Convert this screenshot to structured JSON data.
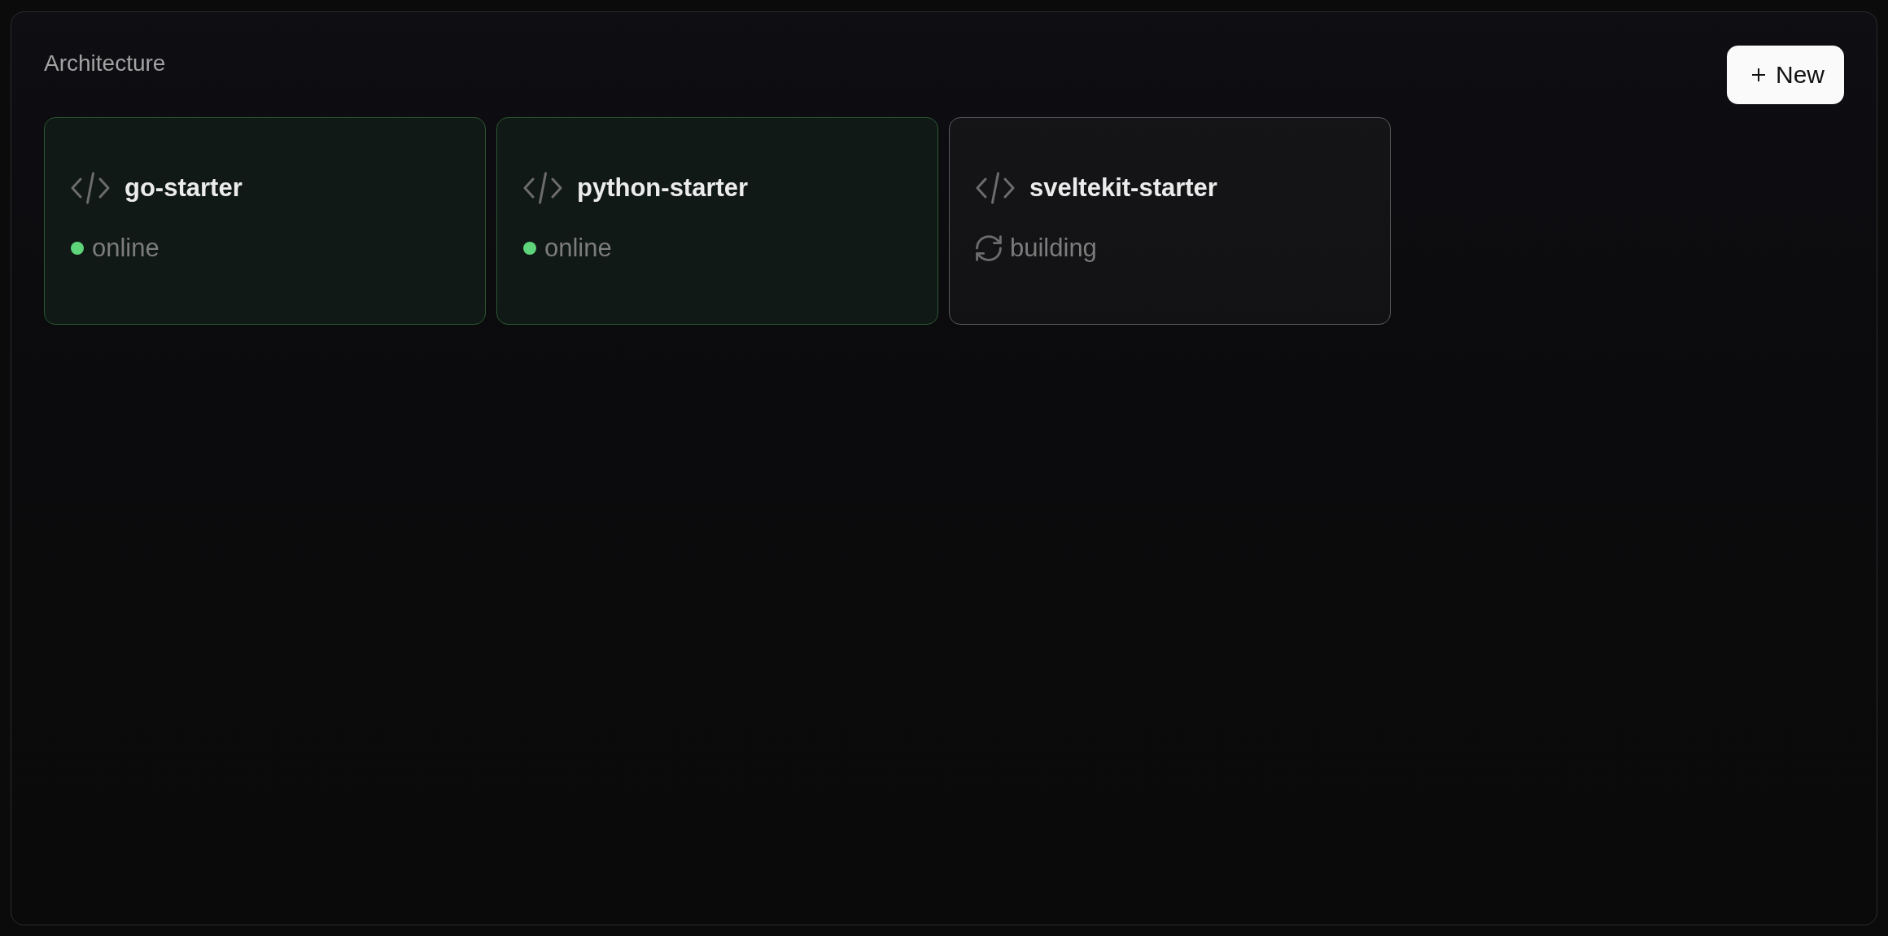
{
  "panel": {
    "title": "Architecture"
  },
  "new_button": {
    "label": "New"
  },
  "services": [
    {
      "name": "go-starter",
      "status": {
        "kind": "online",
        "label": "online",
        "color": "#5ed47b"
      }
    },
    {
      "name": "python-starter",
      "status": {
        "kind": "online",
        "label": "online",
        "color": "#5ed47b"
      }
    },
    {
      "name": "sveltekit-starter",
      "status": {
        "kind": "building",
        "label": "building"
      }
    }
  ]
}
